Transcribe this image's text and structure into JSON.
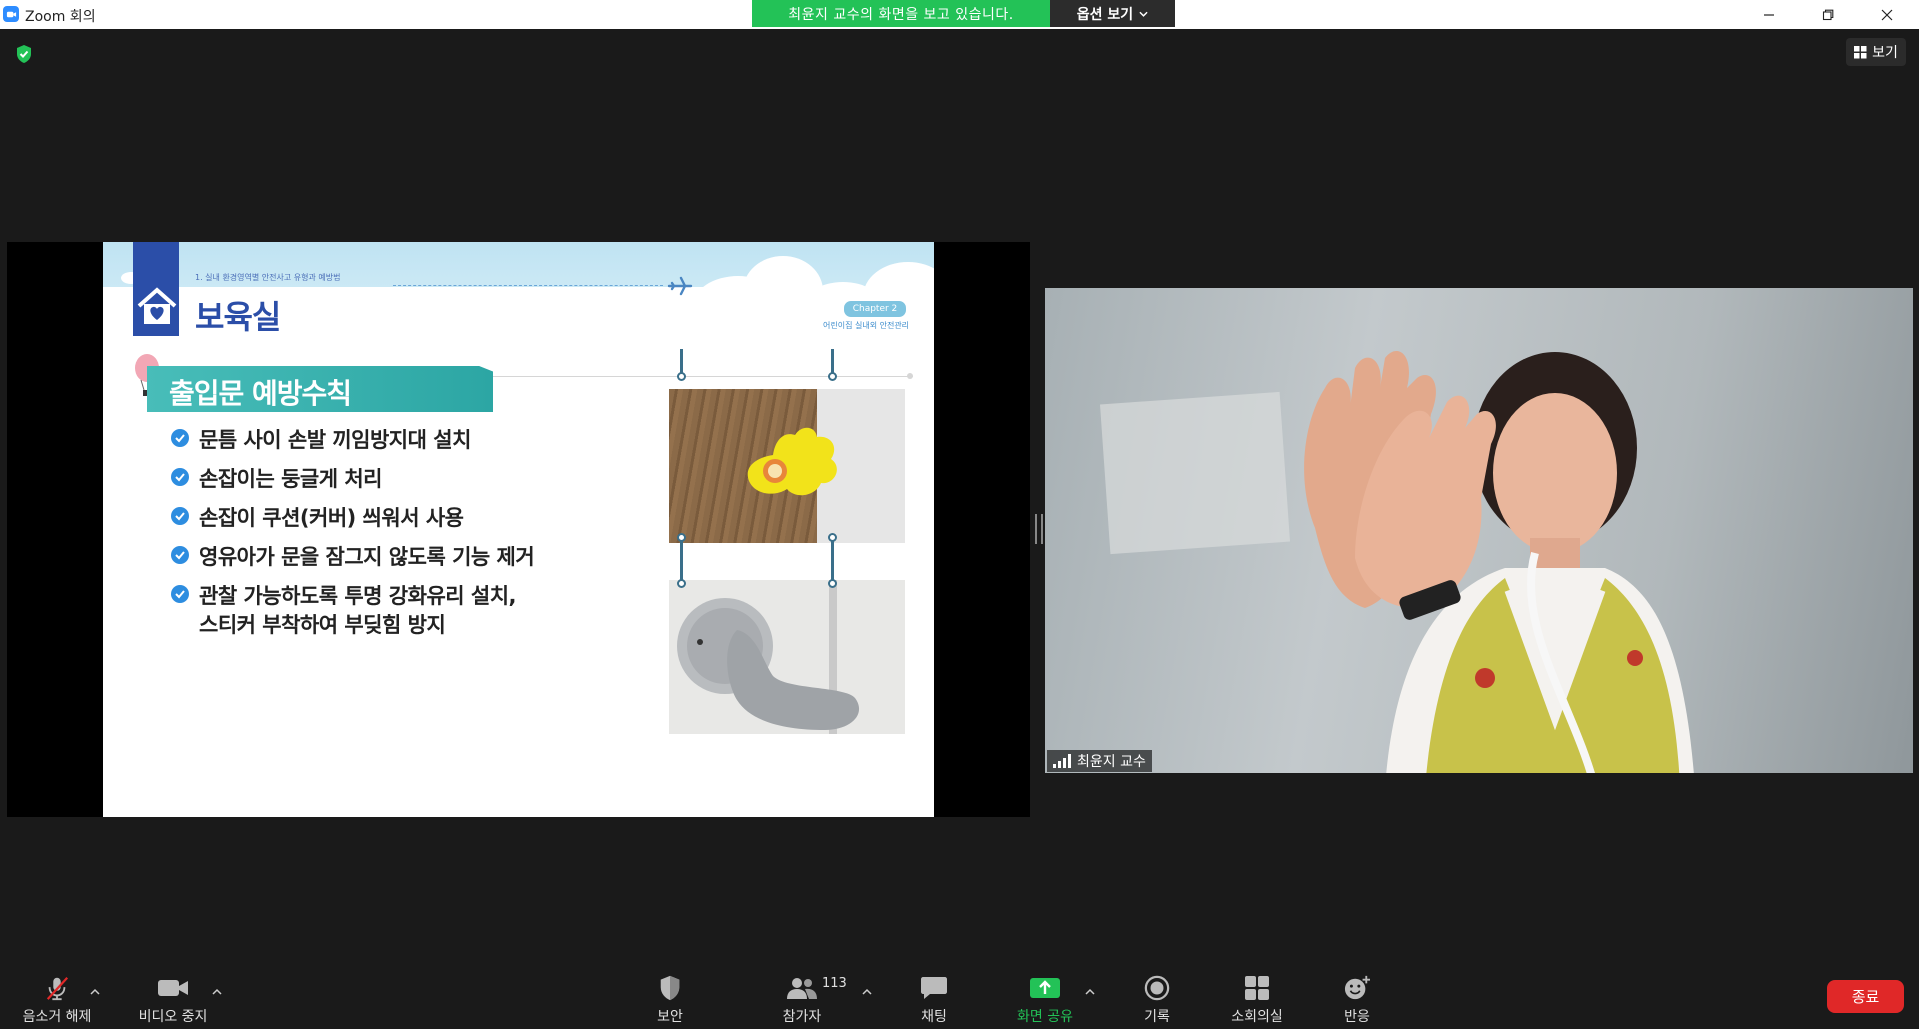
{
  "window": {
    "title": "Zoom 회의",
    "banner_text": "최윤지 교수의 화면을 보고 있습니다.",
    "options_label": "옵션 보기"
  },
  "topbar": {
    "view_label": "보기"
  },
  "slide": {
    "breadcrumb": "1. 실내 환경영역별 안전사고 유형과 예방법",
    "title": "보육실",
    "chapter": "Chapter 2",
    "chapter_sub": "어린이집 실내외 안전관리",
    "section_title": "출입문 예방수칙",
    "bullets": [
      "문틈 사이 손발 끼임방지대 설치",
      "손잡이는 둥글게 처리",
      "손잡이 쿠션(커버) 씌워서 사용",
      "영유아가 문을 잠그지 않도록 기능 제거",
      "관찰 가능하도록 투명 강화유리 설치,"
    ],
    "bullet_continuation": "스티커 부착하여 부딪힘 방지"
  },
  "participant": {
    "name": "최윤지 교수"
  },
  "toolbar": {
    "mute_label": "음소거 해제",
    "video_label": "비디오 중지",
    "security_label": "보안",
    "participants_label": "참가자",
    "participants_count": "113",
    "chat_label": "채팅",
    "share_label": "화면 공유",
    "record_label": "기록",
    "breakout_label": "소회의실",
    "reactions_label": "반응",
    "end_label": "종료"
  },
  "colors": {
    "banner_green": "#23c257",
    "end_red": "#e02828",
    "slide_blue": "#2b4ea8",
    "slide_teal": "#2ca6a4"
  }
}
